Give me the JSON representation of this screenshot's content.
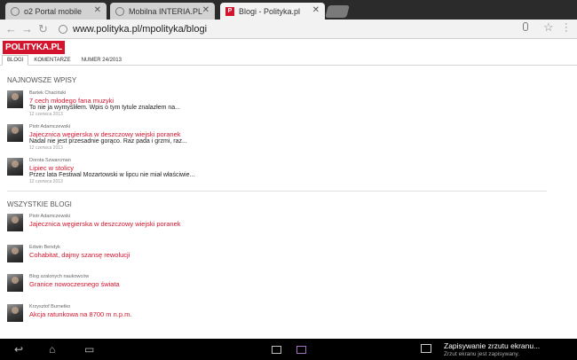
{
  "tabs": [
    {
      "label": "o2 Portal mobile",
      "icon": "globe-icon"
    },
    {
      "label": "Mobilna INTERIA.PL",
      "icon": "globe-icon"
    },
    {
      "label": "Blogi - Polityka.pl",
      "icon": "polityka-favicon",
      "active": true
    }
  ],
  "toolbar": {
    "url": "www.polityka.pl/mpolityka/blogi"
  },
  "site": {
    "logo": "POLITYKA.PL",
    "nav": [
      "BLOGI",
      "KOMENTARZE",
      "NUMER 24/2013"
    ]
  },
  "latest": {
    "title": "NAJNOWSZE WPISY",
    "items": [
      {
        "author": "Bartek Chaciński",
        "title": "7 cech młodego fana muzyki",
        "excerpt": "To nie ja wymyśliłem. Wpis o tym tytule znalazłem na...",
        "date": "12 czerwca 2013"
      },
      {
        "author": "Piotr Adamczewski",
        "title": "Jajecznica węgierska w deszczowy wiejski poranek",
        "excerpt": "Nadal nie jest przesadnie gorąco. Raz pada i grzmi, raz...",
        "date": "12 czerwca 2013"
      },
      {
        "author": "Dorota Szwarcman",
        "title": "Lipiec w stolicy",
        "excerpt": "Przez lata Festiwal Mozartowski w lipcu nie miał właściwie...",
        "date": "12 czerwca 2013"
      }
    ]
  },
  "all_blogs": {
    "title": "WSZYSTKIE BLOGI",
    "items": [
      {
        "author": "Piotr Adamczewski",
        "title": "Jajecznica węgierska w deszczowy wiejski poranek"
      },
      {
        "author": "Edwin Bendyk",
        "title": "Cohabitat, dajmy szansę rewolucji"
      },
      {
        "author": "Blog szalonych naukowców",
        "title": "Granice nowoczesnego świata"
      },
      {
        "author": "Krzysztof Burnetko",
        "title": "Akcja ratunkowa na 8700 m n.p.m."
      }
    ]
  },
  "notification": {
    "title": "Zapisywanie zrzutu ekranu...",
    "subtitle": "Zrzut ekranu jest zapisywany."
  },
  "colors": {
    "accent": "#d3142c",
    "tabstrip": "#2b2b2b",
    "systembar": "#000000"
  }
}
